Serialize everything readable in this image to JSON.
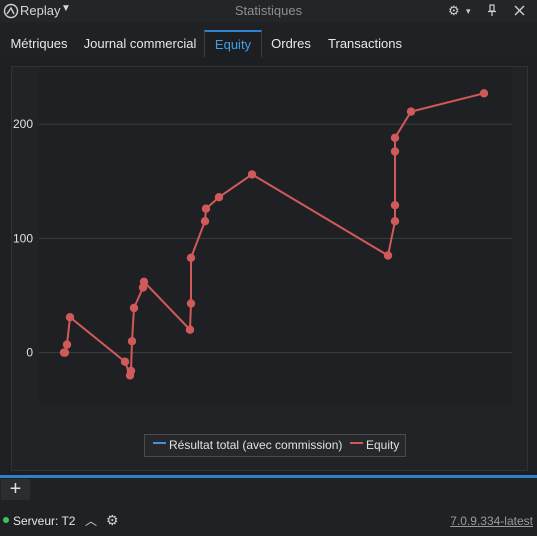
{
  "titlebar": {
    "app_name": "Replay",
    "caret": "▼",
    "window_title": "Statistiques",
    "icons": [
      "app-logo-icon",
      "gear-icon",
      "pin-icon",
      "close-icon"
    ]
  },
  "tabs": [
    {
      "label": "Métriques",
      "active": false
    },
    {
      "label": "Journal commercial",
      "active": false
    },
    {
      "label": "Equity",
      "active": true
    },
    {
      "label": "Ordres",
      "active": false
    },
    {
      "label": "Transactions",
      "active": false
    }
  ],
  "colors": {
    "accent": "#2f82d0",
    "equity": "#d05a5a",
    "total_result": "#4a90d9",
    "status_ok": "#3cc25f"
  },
  "chart_data": {
    "type": "line",
    "ylim": [
      -45,
      250
    ],
    "yticks": [
      0,
      100,
      200
    ],
    "grid": true,
    "legend_position": "bottom-center",
    "series": [
      {
        "name": "Résultat total (avec commission)",
        "values": []
      },
      {
        "name": "Equity",
        "values": [
          0,
          0,
          7,
          31,
          -8,
          -20,
          -16,
          10,
          39,
          57,
          62,
          20,
          43,
          83,
          115,
          126,
          136,
          156,
          85,
          115,
          129,
          176,
          188,
          211,
          227
        ]
      }
    ]
  },
  "legend": {
    "total_result": "Résultat total (avec commission)",
    "equity": "Equity"
  },
  "footer": {
    "add_label": "+",
    "server_label": "Serveur: T2",
    "version": "7.0.9.334-latest"
  }
}
